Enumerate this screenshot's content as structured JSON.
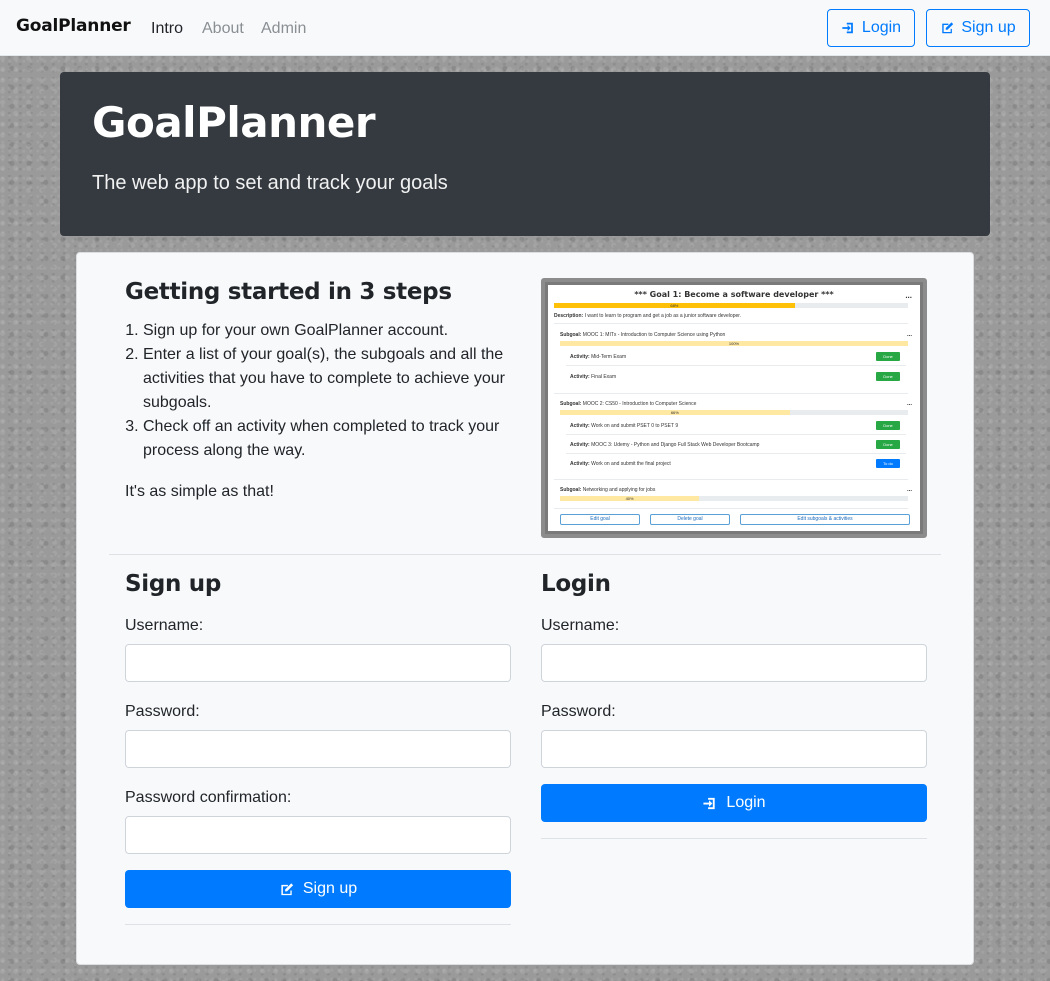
{
  "navbar": {
    "brand": "GoalPlanner",
    "links": [
      "Intro",
      "About",
      "Admin"
    ],
    "login_label": "Login",
    "signup_label": "Sign up"
  },
  "jumbotron": {
    "title": "GoalPlanner",
    "subtitle": "The web app to set and track your goals"
  },
  "intro": {
    "heading": "Getting started in 3 steps",
    "steps": [
      "Sign up for your own GoalPlanner account.",
      "Enter a list of your goal(s), the subgoals and all the activities that you have to complete to achieve your subgoals.",
      "Check off an activity when completed to track your process along the way."
    ],
    "closing": "It's as simple as that!"
  },
  "preview": {
    "goal_title": "*** Goal 1: Become a software developer ***",
    "menu": "...",
    "goal_progress": 0.68,
    "goal_progress_label": "68%",
    "description_label": "Description:",
    "description": "I want to learn to program and get a job as a junior software developer.",
    "subgoals": [
      {
        "label": "Subgoal:",
        "name": "MOOC 1: MITx - Introduction to Computer Science using Python",
        "progress": 1.0,
        "progress_label": "100%",
        "activities": [
          {
            "label": "Activity:",
            "name": "Mid-Term Exam",
            "status": "Done"
          },
          {
            "label": "Activity:",
            "name": "Final Exam",
            "status": "Done"
          }
        ]
      },
      {
        "label": "Subgoal:",
        "name": "MOOC 2: CS50 - Introduction to Computer Science",
        "progress": 0.66,
        "progress_label": "66%",
        "activities": [
          {
            "label": "Activity:",
            "name": "Work on and submit PSET 0 to PSET 9",
            "status": "Done"
          },
          {
            "label": "Activity:",
            "name": "MOOC 3: Udemy - Python and Django Full Stack Web Developer Bootcamp",
            "status": "Done"
          },
          {
            "label": "Activity:",
            "name": "Work on and submit the final project",
            "status": "To do"
          }
        ]
      },
      {
        "label": "Subgoal:",
        "name": "Networking and applying for jobs",
        "progress": 0.4,
        "progress_label": "40%",
        "activities": []
      }
    ],
    "buttons": [
      "Edit goal",
      "Delete goal",
      "Edit subgoals & activities"
    ],
    "colors": {
      "done": "#28a745",
      "todo": "#007bff",
      "progress": "#ffc107"
    }
  },
  "signup": {
    "heading": "Sign up",
    "username_label": "Username:",
    "password_label": "Password:",
    "confirm_label": "Password confirmation:",
    "button_label": "Sign up"
  },
  "login": {
    "heading": "Login",
    "username_label": "Username:",
    "password_label": "Password:",
    "button_label": "Login"
  },
  "colors": {
    "primary": "#007bff",
    "dark": "#343a40",
    "light": "#f8f9fa"
  }
}
